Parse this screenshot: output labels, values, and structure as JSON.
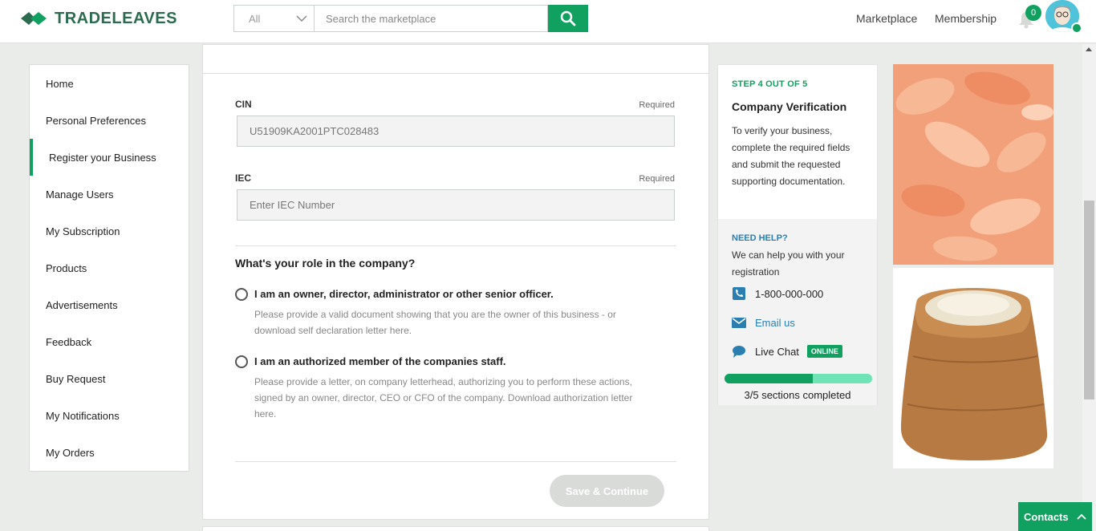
{
  "header": {
    "brand": "TRADELEAVES",
    "search": {
      "category": "All",
      "placeholder": "Search the marketplace"
    },
    "nav": {
      "marketplace": "Marketplace",
      "membership": "Membership"
    },
    "notifications_count": "0"
  },
  "sidebar": {
    "items": [
      {
        "label": "Home"
      },
      {
        "label": "Personal Preferences"
      },
      {
        "label": "Register your Business"
      },
      {
        "label": "Manage Users"
      },
      {
        "label": "My Subscription"
      },
      {
        "label": "Products"
      },
      {
        "label": "Advertisements"
      },
      {
        "label": "Feedback"
      },
      {
        "label": "Buy Request"
      },
      {
        "label": "My Notifications"
      },
      {
        "label": "My Orders"
      }
    ],
    "active_index": 2
  },
  "form": {
    "cin": {
      "label": "CIN",
      "required": "Required",
      "value": "U51909KA2001PTC028483"
    },
    "iec": {
      "label": "IEC",
      "required": "Required",
      "placeholder": "Enter IEC Number"
    },
    "role": {
      "title": "What's your role in the company?",
      "options": [
        {
          "label": "I am an owner, director, administrator or other senior officer.",
          "help": "Please provide a valid document showing that you are the owner of this business - or download self declaration letter here."
        },
        {
          "label": "I am an authorized member of the companies staff.",
          "help": "Please provide a letter, on company letterhead, authorizing you to perform these actions, signed by an owner, director, CEO or CFO of the company. Download authorization letter here."
        }
      ]
    },
    "save_label": "Save & Continue"
  },
  "step": {
    "label": "STEP 4 OUT OF 5",
    "title": "Company Verification",
    "description": "To verify your business, complete the required fields and submit the requested supporting documentation.",
    "help_title": "NEED HELP?",
    "help_desc": "We can help you with your registration",
    "phone": "1-800-000-000",
    "email": "Email us",
    "chat": "Live Chat",
    "chat_status": "ONLINE",
    "progress_fraction": 0.6,
    "progress_text": "3/5 sections completed"
  },
  "contacts_label": "Contacts",
  "colors": {
    "accent": "#10a060",
    "link": "#2a7fb0"
  }
}
